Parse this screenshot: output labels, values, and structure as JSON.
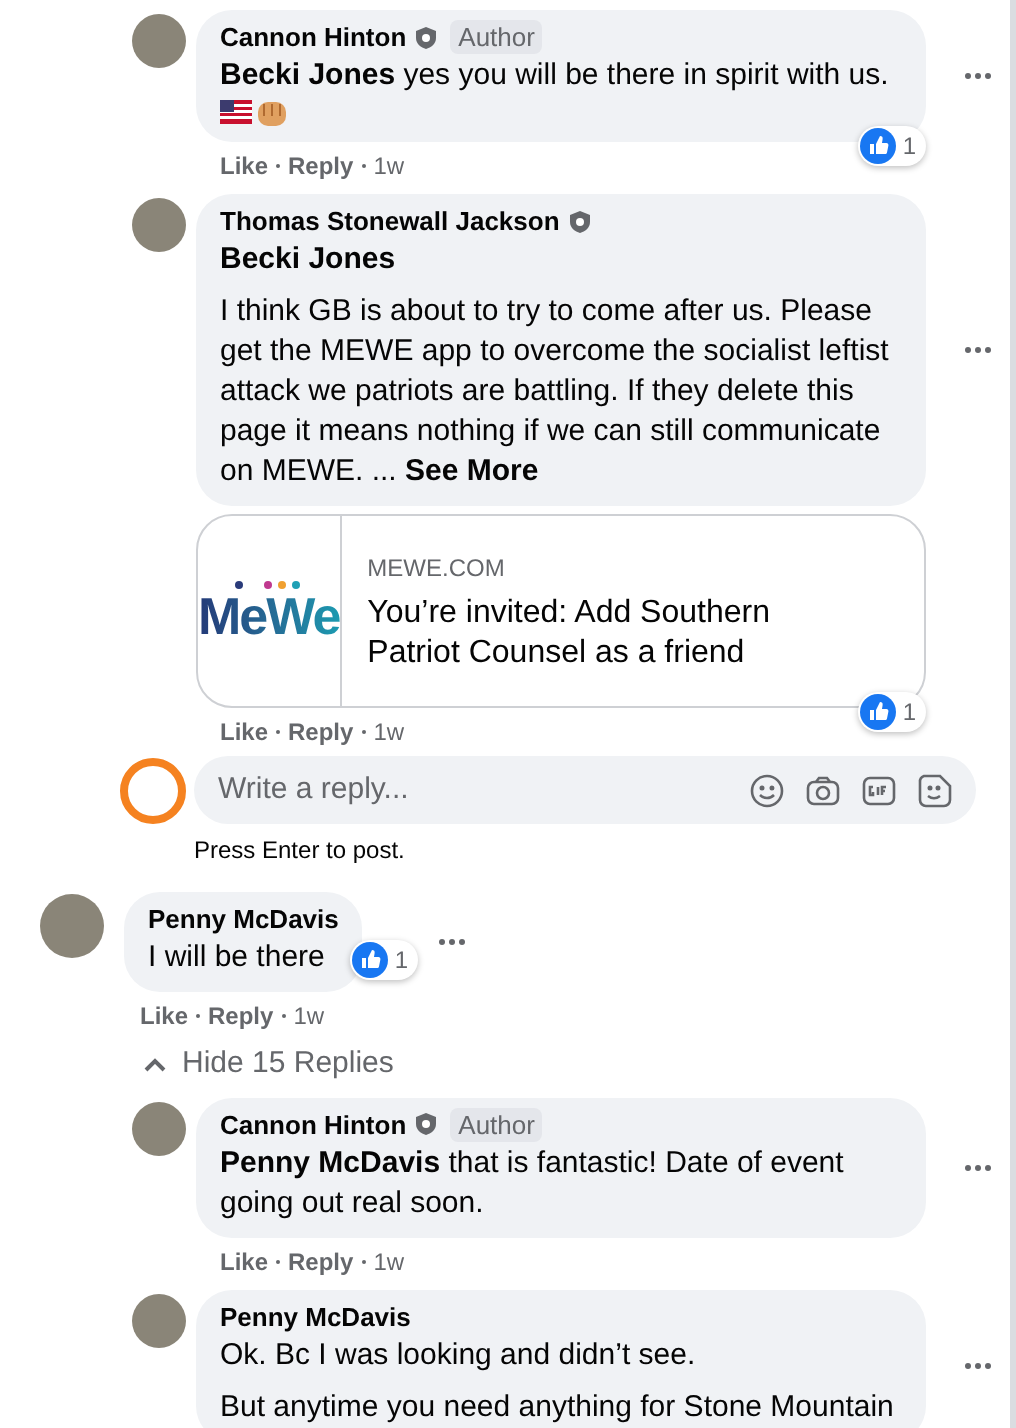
{
  "comments": [
    {
      "kind": "reply",
      "author": "Cannon Hinton",
      "shield": true,
      "badge": "Author",
      "paragraphs": [
        "**Becki Jones** yes you will be there in spirit with us."
      ],
      "emoji_row": true,
      "likes": "1",
      "actions": [
        "Like",
        "Reply",
        "1w"
      ]
    },
    {
      "kind": "reply",
      "author": "Thomas Stonewall Jackson",
      "shield": true,
      "paragraphs": [
        "**Becki Jones**",
        "I think GB is about to try to come after us. Please get the MEWE app to overcome the socialist leftist attack we patriots are battling. If they delete this page it means nothing if we can still communicate on MEWE. ... **See More**"
      ],
      "link": {
        "logo": "MeWe",
        "domain": "MEWE.COM",
        "title": "You’re invited: Add Southern Patriot Counsel as a friend"
      },
      "likes": "1",
      "actions": [
        "Like",
        "Reply",
        "1w"
      ]
    },
    {
      "kind": "reply_box",
      "placeholder": "Write a reply...",
      "hint": "Press Enter to post."
    },
    {
      "kind": "comment",
      "author": "Penny McDavis",
      "shield": false,
      "paragraphs": [
        "I will be there"
      ],
      "likes": "1",
      "actions": [
        "Like",
        "Reply",
        "1w"
      ]
    },
    {
      "kind": "toggle",
      "label": "Hide 15 Replies",
      "expanded": true
    },
    {
      "kind": "reply",
      "author": "Cannon Hinton",
      "shield": true,
      "badge": "Author",
      "paragraphs": [
        "**Penny McDavis** that is fantastic! Date of event going out real soon."
      ],
      "actions": [
        "Like",
        "Reply",
        "1w"
      ]
    },
    {
      "kind": "reply",
      "author": "Penny McDavis",
      "shield": false,
      "paragraphs": [
        "Ok. Bc I was looking and didn’t see.",
        "But anytime you need anything for Stone Mountain"
      ]
    }
  ]
}
